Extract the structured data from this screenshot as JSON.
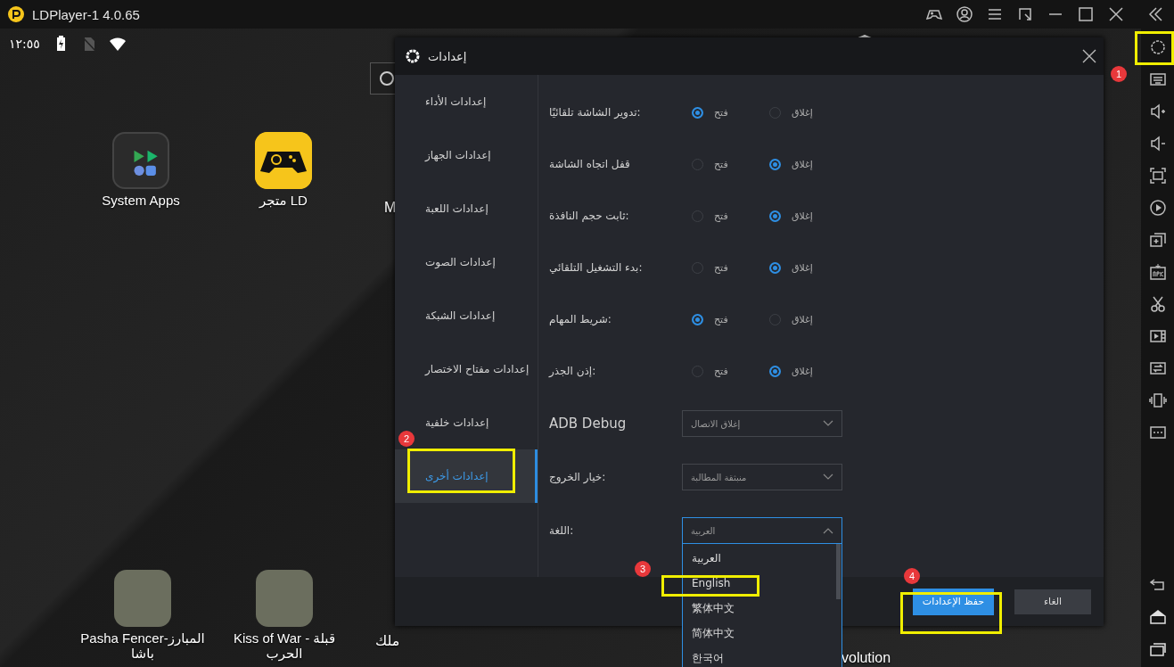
{
  "window": {
    "title": "LDPlayer-1 4.0.65"
  },
  "status_bar": {
    "time": "١٢:٥٥"
  },
  "desktop_apps": [
    {
      "label": "M",
      "kind": "hidden"
    },
    {
      "label": "متجر LD",
      "kind": "store"
    },
    {
      "label": "System Apps",
      "kind": "folder"
    },
    {
      "label": "volution",
      "kind": "hidden"
    },
    {
      "label": "ملك",
      "kind": "hidden"
    },
    {
      "label": "Kiss of War - قبلة الحرب",
      "kind": "photo"
    },
    {
      "label": "Pasha Fencer-المبارز باشا",
      "kind": "photo"
    }
  ],
  "settings_dialog": {
    "title": "إعدادات",
    "sidebar": {
      "items": [
        {
          "label": "إعدادات الأداء",
          "selected": false
        },
        {
          "label": "إعدادات الجهاز",
          "selected": false
        },
        {
          "label": "إعدادات اللعبة",
          "selected": false
        },
        {
          "label": "إعدادات الصوت",
          "selected": false
        },
        {
          "label": "إعدادات الشبكة",
          "selected": false
        },
        {
          "label": "إعدادات مفتاح الاختصار",
          "selected": false
        },
        {
          "label": "إعدادات خلفية",
          "selected": false
        },
        {
          "label": "إعدادات أخرى",
          "selected": true
        }
      ]
    },
    "toggle_rows": [
      {
        "label": "تدوير الشاشة تلقائيًا:",
        "options": [
          {
            "label": "إغلاق",
            "selected": false
          },
          {
            "label": "فتح",
            "selected": true
          }
        ]
      },
      {
        "label": "قفل اتجاه الشاشة",
        "options": [
          {
            "label": "إغلاق",
            "selected": true
          },
          {
            "label": "فتح",
            "selected": false
          }
        ]
      },
      {
        "label": "ثابت حجم النافذة:",
        "options": [
          {
            "label": "إغلاق",
            "selected": true
          },
          {
            "label": "فتح",
            "selected": false
          }
        ]
      },
      {
        "label": "بدء التشغيل التلقائي:",
        "options": [
          {
            "label": "إغلاق",
            "selected": true
          },
          {
            "label": "فتح",
            "selected": false
          }
        ]
      },
      {
        "label": "شريط المهام:",
        "options": [
          {
            "label": "إغلاق",
            "selected": false
          },
          {
            "label": "فتح",
            "selected": true
          }
        ]
      },
      {
        "label": "إذن الجذر:",
        "options": [
          {
            "label": "إغلاق",
            "selected": true
          },
          {
            "label": "فتح",
            "selected": false
          }
        ]
      }
    ],
    "select_rows": [
      {
        "label": "ADB Debug",
        "value": "إغلاق الاتصال",
        "expanded": false
      },
      {
        "label": "خيار الخروج:",
        "value": "منبثقة المطالبة",
        "expanded": false
      },
      {
        "label": "اللغة:",
        "value": "العربية",
        "expanded": true,
        "options": [
          "العربية",
          "English",
          "繁体中文",
          "简体中文",
          "한국어"
        ]
      }
    ],
    "buttons": [
      {
        "label": "الغاء",
        "kind": "secondary"
      },
      {
        "label": "حفظ الإعدادات",
        "kind": "primary"
      }
    ]
  },
  "annotations": [
    {
      "number": "1"
    },
    {
      "number": "2"
    },
    {
      "number": "3"
    },
    {
      "number": "4"
    }
  ]
}
